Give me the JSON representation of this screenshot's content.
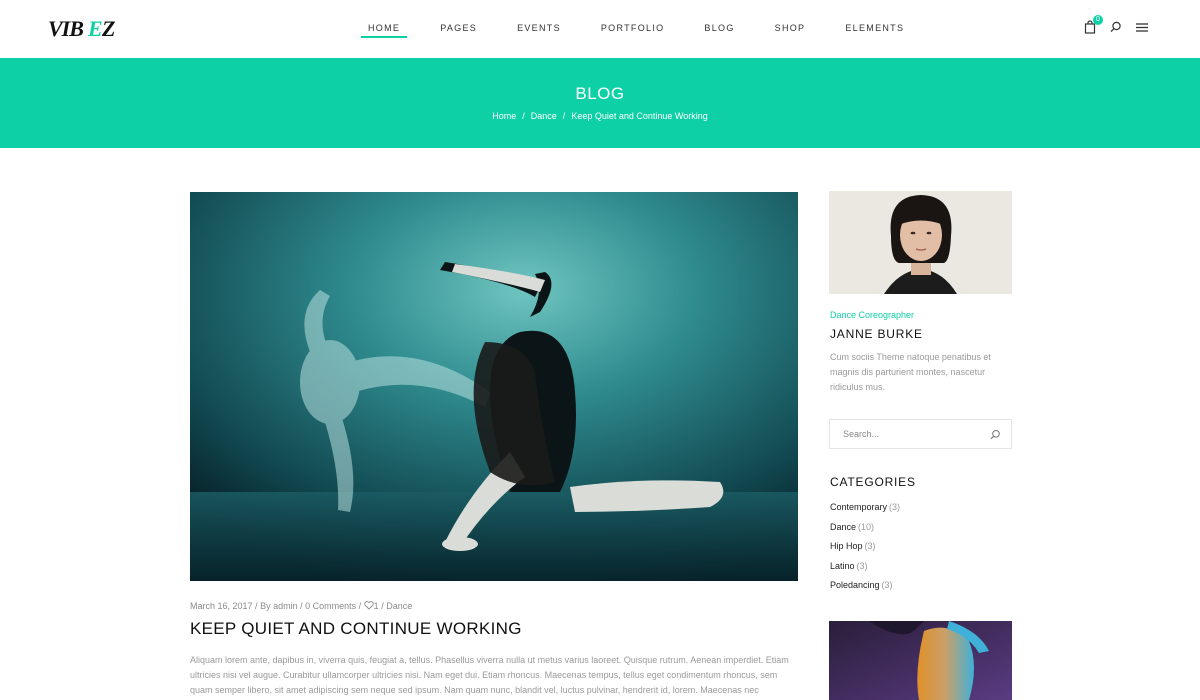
{
  "header": {
    "logo_text": "VIBEZ",
    "nav": [
      {
        "label": "HOME",
        "active": true
      },
      {
        "label": "PAGES",
        "active": false
      },
      {
        "label": "EVENTS",
        "active": false
      },
      {
        "label": "PORTFOLIO",
        "active": false
      },
      {
        "label": "BLOG",
        "active": false
      },
      {
        "label": "SHOP",
        "active": false
      },
      {
        "label": "ELEMENTS",
        "active": false
      }
    ],
    "cart_count": "0",
    "icons": [
      "shopping-bag-icon",
      "search-icon",
      "hamburger-menu-icon"
    ]
  },
  "hero": {
    "title": "BLOG",
    "breadcrumb": [
      "Home",
      "Dance",
      "Keep Quiet and Continue Working"
    ],
    "separator": "/"
  },
  "post": {
    "meta": {
      "date": "March 16, 2017",
      "by": "By",
      "author": "admin",
      "comments": "0 Comments",
      "likes": "1",
      "category": "Dance",
      "separator": " / "
    },
    "title": "KEEP QUIET AND CONTINUE WORKING",
    "excerpt": "Aliquam lorem ante, dapibus in, viverra quis, feugiat a, tellus. Phasellus viverra nulla ut metus varius laoreet. Quisque rutrum. Aenean imperdiet. Etiam ultricies nisi vel augue. Curabitur ullamcorper ultricies nisi. Nam eget dui. Etiam rhoncus. Maecenas tempus, tellus eget condimentum rhoncus, sem quam semper libero, sit amet adipiscing sem neque sed ipsum. Nam quam nunc, blandit vel, luctus pulvinar, hendrerit id, lorem. Maecenas nec"
  },
  "sidebar": {
    "author": {
      "role": "Dance Coreographer",
      "name": "JANNE BURKE",
      "bio": "Cum sociis Theme natoque penatibus et magnis dis parturient montes, nascetur ridiculus mus."
    },
    "search": {
      "placeholder": "Search..."
    },
    "categories": {
      "title": "CATEGORIES",
      "items": [
        {
          "label": "Contemporary",
          "count": "(3)"
        },
        {
          "label": "Dance",
          "count": "(10)"
        },
        {
          "label": "Hip Hop",
          "count": "(3)"
        },
        {
          "label": "Latino",
          "count": "(3)"
        },
        {
          "label": "Poledancing",
          "count": "(3)"
        }
      ]
    }
  },
  "colors": {
    "accent": "#0ed0a6",
    "text_dark": "#111111",
    "text_muted": "#9a9a9a"
  }
}
